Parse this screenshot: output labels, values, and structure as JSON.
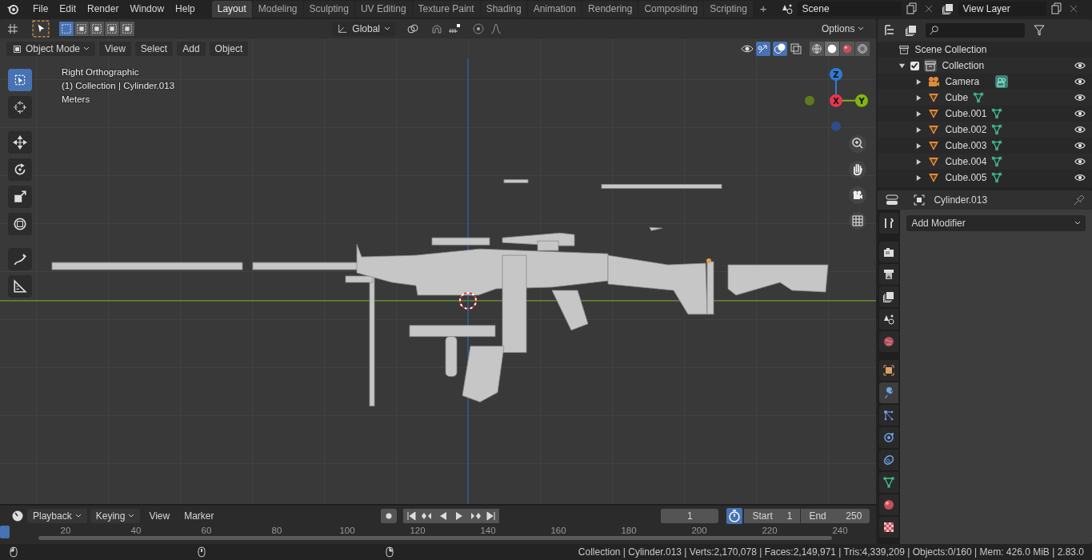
{
  "topbar": {
    "menus": [
      "File",
      "Edit",
      "Render",
      "Window",
      "Help"
    ],
    "workspaces": [
      {
        "label": "Layout",
        "selected": true
      },
      {
        "label": "Modeling",
        "selected": false
      },
      {
        "label": "Sculpting",
        "selected": false
      },
      {
        "label": "UV Editing",
        "selected": false
      },
      {
        "label": "Texture Paint",
        "selected": false
      },
      {
        "label": "Shading",
        "selected": false
      },
      {
        "label": "Animation",
        "selected": false
      },
      {
        "label": "Rendering",
        "selected": false
      },
      {
        "label": "Compositing",
        "selected": false
      },
      {
        "label": "Scripting",
        "selected": false
      }
    ],
    "add_workspace": "+",
    "scene": "Scene",
    "view_layer": "View Layer"
  },
  "viewport": {
    "select_modes": [
      {
        "selected": true
      },
      {
        "selected": false
      },
      {
        "selected": false
      },
      {
        "selected": false
      },
      {
        "selected": false
      }
    ],
    "orientation": "Global",
    "options": "Options",
    "mode": "Object Mode",
    "menus": [
      "View",
      "Select",
      "Add",
      "Object"
    ],
    "shading": [
      {
        "kind": "wire",
        "selected": false
      },
      {
        "kind": "solid",
        "selected": true
      },
      {
        "kind": "material",
        "selected": false
      },
      {
        "kind": "rendered",
        "selected": false
      }
    ],
    "info": [
      "Right Orthographic",
      "(1) Collection | Cylinder.013",
      "Meters"
    ],
    "tools": [
      {
        "kind": "select",
        "selected": true
      },
      {
        "kind": "cursor",
        "selected": false
      },
      {
        "kind": "move",
        "selected": false
      },
      {
        "kind": "rotate",
        "selected": false
      },
      {
        "kind": "scale",
        "selected": false
      },
      {
        "kind": "transform",
        "selected": false
      },
      {
        "kind": "annotate",
        "selected": false
      },
      {
        "kind": "measure",
        "selected": false
      }
    ],
    "gizmo": {
      "z": "Z",
      "x": "X",
      "y": "Y"
    }
  },
  "outliner": {
    "root": "Scene Collection",
    "collection": {
      "label": "Collection",
      "expanded": true,
      "checked": true,
      "children": [
        {
          "label": "Camera",
          "kind": "camera"
        },
        {
          "label": "Cube",
          "kind": "mesh"
        },
        {
          "label": "Cube.001",
          "kind": "mesh"
        },
        {
          "label": "Cube.002",
          "kind": "mesh"
        },
        {
          "label": "Cube.003",
          "kind": "mesh"
        },
        {
          "label": "Cube.004",
          "kind": "mesh"
        },
        {
          "label": "Cube.005",
          "kind": "mesh"
        }
      ]
    }
  },
  "properties": {
    "object": "Cylinder.013",
    "add_modifier": "Add Modifier",
    "tabs": [
      {
        "kind": "tool",
        "selected": false
      },
      {
        "kind": "render",
        "selected": false
      },
      {
        "kind": "output",
        "selected": false
      },
      {
        "kind": "view_layer",
        "selected": false
      },
      {
        "kind": "scene",
        "selected": false
      },
      {
        "kind": "world",
        "selected": false
      },
      {
        "kind": "object",
        "selected": false
      },
      {
        "kind": "modifier",
        "selected": true
      },
      {
        "kind": "particles",
        "selected": false
      },
      {
        "kind": "physics",
        "selected": false
      },
      {
        "kind": "constraints",
        "selected": false
      },
      {
        "kind": "data",
        "selected": false
      },
      {
        "kind": "material",
        "selected": false
      },
      {
        "kind": "texture",
        "selected": false
      }
    ]
  },
  "timeline": {
    "menus": [
      {
        "label": "Playback",
        "dropdown": true
      },
      {
        "label": "Keying",
        "dropdown": true
      },
      {
        "label": "View",
        "dropdown": false
      },
      {
        "label": "Marker",
        "dropdown": false
      }
    ],
    "current_frame": "1",
    "start_label": "Start",
    "start": "1",
    "end_label": "End",
    "end": "250",
    "ticks": [
      "20",
      "40",
      "60",
      "80",
      "100",
      "120",
      "140",
      "160",
      "180",
      "200",
      "220",
      "240"
    ]
  },
  "status": "Collection | Cylinder.013 | Verts:2,170,078 | Faces:2,149,971 | Tris:4,339,209 | Objects:0/160 | Mem: 426.0 MiB | 2.83.0"
}
